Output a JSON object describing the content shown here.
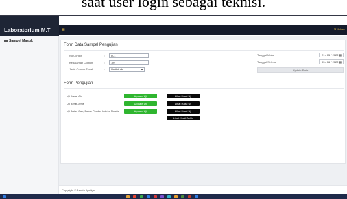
{
  "caption": "saat user login sebagai teknisi.",
  "browser": {
    "tab_title": "Laboratorium Mekanika Tanah",
    "tab_close": "×",
    "new_tab": "+",
    "minimize": "–",
    "close": "×",
    "url_host": "localhost",
    "url_path": "/mekanika/tracking/sampel_masuk/input_hasil/1"
  },
  "app": {
    "brand": "Laboratorium M.T",
    "menu_icon": "≡",
    "logout": "Keluar"
  },
  "sidebar": {
    "items": [
      {
        "label": "Sampel Masuk"
      }
    ]
  },
  "form": {
    "title": "Form Data Sampel Pengujian",
    "fields": [
      {
        "label": "No Contoh",
        "value": "U-1"
      },
      {
        "label": "Kedalaman Contoh",
        "value": "1m"
      },
      {
        "label": "Jenis Contoh Tanah",
        "value": "Undisturb"
      }
    ],
    "tanggal_mulai_label": "Tanggal Mulai",
    "tanggal_mulai": "21 / 05 / 2022",
    "tanggal_selesai_label": "Tanggal Selesai",
    "tanggal_selesai": "03 / 06 / 2022",
    "update_label": "Update Data"
  },
  "pengujian": {
    "title": "Form Pengujian",
    "rows": [
      {
        "label": "Uji Kadar Air",
        "update": "Update Uji",
        "view": "Lihat Hasil Uji"
      },
      {
        "label": "Uji Berat Jenis",
        "update": "Update Uji",
        "view": "Lihat Hasil Uji"
      },
      {
        "label": "Uji Batas Cair, Batas Plastis, Indeks Plastis",
        "update": "Update Uji",
        "view": "Lihat Hasil Uji"
      }
    ],
    "view_all": "Lihat Hasil Akhir"
  },
  "footer": {
    "text": "Copyright © Arneta Apriliya"
  },
  "colors": {
    "sidebar_header": "#1e2535",
    "app_bar": "#151b2b",
    "accent": "#f0c34a",
    "update_button": "#2fb52f",
    "view_button": "#0a0a0a"
  }
}
